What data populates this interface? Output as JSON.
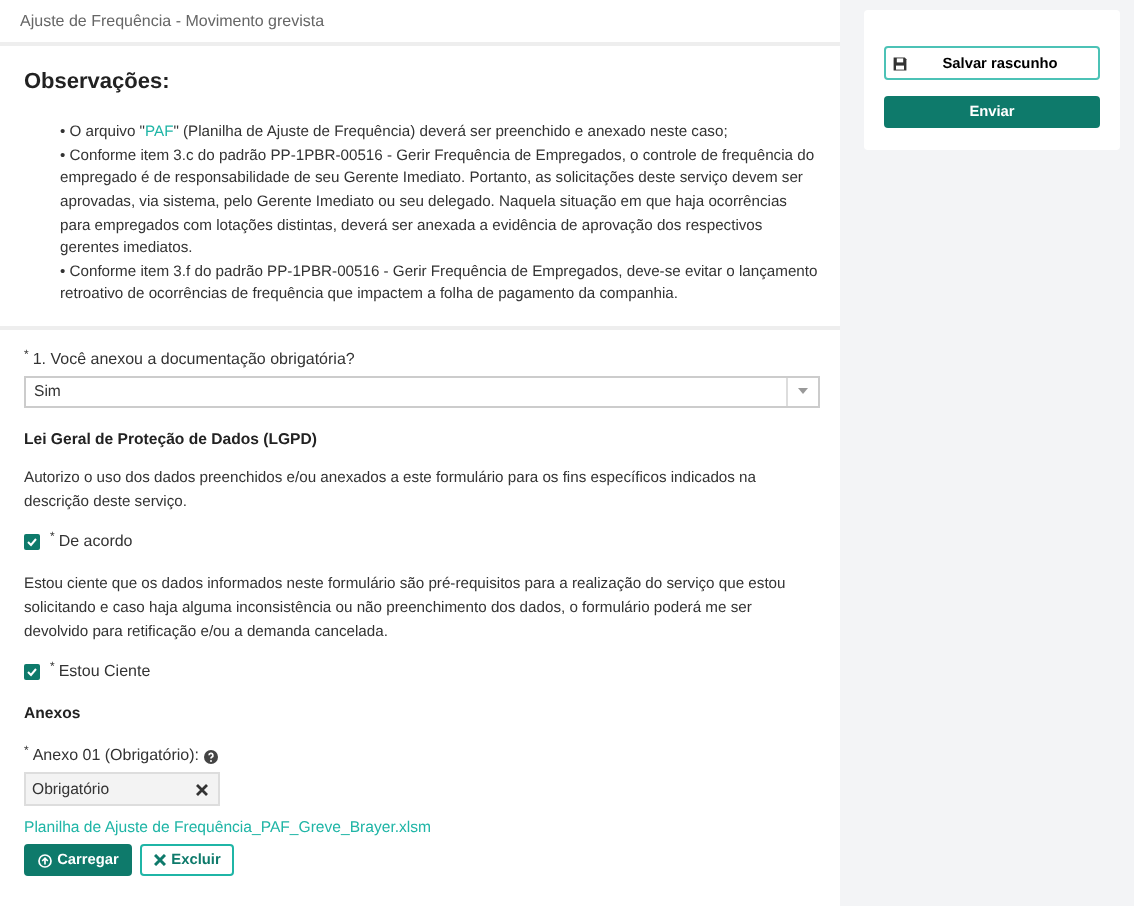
{
  "breadcrumb": "Ajuste de Frequência - Movimento grevista",
  "observations": {
    "title": "Observações:",
    "items": [
      {
        "parts": [
          {
            "text": "• O arquivo \"",
            "kind": "plain"
          },
          {
            "text": "PAF",
            "kind": "link"
          },
          {
            "text": "\" (Planilha de Ajuste de Frequência) deverá ser preenchido e anexado neste caso;",
            "kind": "plain"
          }
        ]
      },
      {
        "parts": [
          {
            "text": "• Conforme item 3.c do padrão PP-1PBR-00516 - Gerir Frequência de Empregados, o controle de frequência do empregado é de responsabilidade de seu Gerente Imediato. Portanto, as solicitações deste serviço devem ser aprovadas, via sistema, pelo Gerente Imediato ou seu delegado. Naquela situação em que haja ocorrências para empregados com lotações distintas, deverá ser anexada a evidência de aprovação dos respectivos gerentes imediatos.",
            "kind": "plain"
          }
        ]
      },
      {
        "parts": [
          {
            "text": "• Conforme item 3.f do padrão PP-1PBR-00516 - Gerir Frequência de Empregados, deve-se evitar o lançamento retroativo de ocorrências de frequência que impactem a folha de pagamento da companhia.",
            "kind": "plain"
          }
        ]
      }
    ]
  },
  "question": {
    "required_mark": "*",
    "label": "1. Você anexou a documentação obrigatória?",
    "value": "Sim"
  },
  "lgpd": {
    "title": "Lei Geral de Proteção de Dados (LGPD)",
    "blocks": [
      {
        "text": "Autorizo o uso dos dados preenchidos e/ou anexados a este formulário para os fins específicos indicados na descrição deste serviço.",
        "required_mark": "*",
        "checkbox_label": "De acordo",
        "checked": true
      },
      {
        "text": "Estou ciente que os dados informados neste formulário são pré-requisitos para a realização do serviço que estou solicitando e caso haja alguma inconsistência ou não preenchimento dos dados, o formulário poderá me ser devolvido para retificação e/ou a demanda cancelada.",
        "required_mark": "*",
        "checkbox_label": "Estou Ciente",
        "checked": true
      }
    ]
  },
  "attachments": {
    "title": "Anexos",
    "required_mark": "*",
    "label": "Anexo 01 (Obrigatório):",
    "field_value": "Obrigatório",
    "file_link": "Planilha de Ajuste de Frequência_PAF_Greve_Brayer.xlsm",
    "upload_button": "Carregar",
    "delete_button": "Excluir"
  },
  "actions": {
    "save_draft": "Salvar rascunho",
    "submit": "Enviar"
  }
}
